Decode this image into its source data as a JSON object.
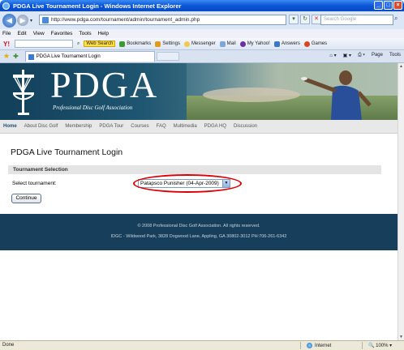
{
  "window": {
    "title": "PDGA Live Tournament Login - Windows Internet Explorer",
    "min_label": "_",
    "max_label": "□",
    "close_label": "×"
  },
  "addressbar": {
    "url": "http://www.pdga.com/tournament/admin/tournament_admin.php",
    "search_placeholder": "Search Google",
    "back_glyph": "◀",
    "forward_glyph": "▶",
    "refresh_glyph": "↻",
    "stop_glyph": "✕",
    "search_glyph": "⌕"
  },
  "menubar": {
    "items": [
      "File",
      "Edit",
      "View",
      "Favorites",
      "Tools",
      "Help"
    ]
  },
  "yahoo_toolbar": {
    "logo": "Y!",
    "web_search": "Web Search",
    "bookmarks": "Bookmarks",
    "settings": "Settings",
    "messenger": "Messenger",
    "mail": "Mail",
    "my_yahoo": "My Yahoo!",
    "answers": "Answers",
    "games": "Games"
  },
  "tabbar": {
    "tab_title": "PDGA Live Tournament Login",
    "page_menu": "Page",
    "tools_menu": "Tools"
  },
  "site": {
    "logo_text": "PDGA",
    "logo_subtitle": "Professional Disc Golf Association",
    "nav": [
      "Home",
      "About Disc Golf",
      "Membership",
      "PDGA Tour",
      "Courses",
      "FAQ",
      "Multimedia",
      "PDGA HQ",
      "Discussion"
    ]
  },
  "main": {
    "page_title": "PDGA Live Tournament Login",
    "section_title": "Tournament Selection",
    "select_label": "Select tournament:",
    "selected_tournament": "Patapsco Punisher (04-Apr-2009)",
    "continue_label": "Continue"
  },
  "footer": {
    "copyright": "© 2008 Professional Disc Golf Association. All rights reserved.",
    "address": "IDGC - Wildwood Park, 3828 Dogwood Lane, Appling, GA 30802-3012 PH:706-261-6342"
  },
  "statusbar": {
    "status": "Done",
    "zone": "Internet",
    "zoom": "100%"
  },
  "colors": {
    "banner": "#1e5570",
    "footer": "#173f5b",
    "highlight_circle": "#dd0000"
  }
}
